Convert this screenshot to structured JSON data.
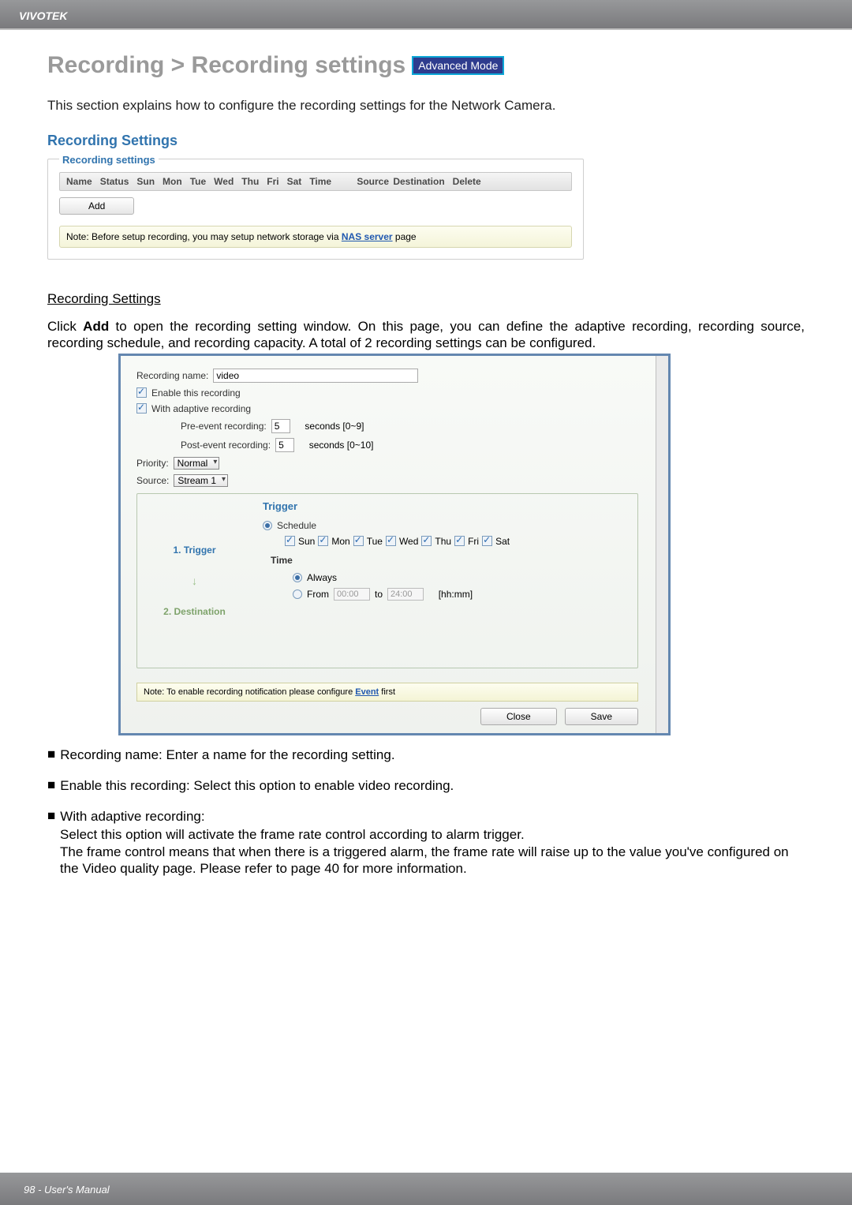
{
  "brand": "VIVOTEK",
  "page_title_prefix": "Recording > Recording settings",
  "mode_badge": "Advanced Mode",
  "intro": "This section explains how to configure the recording settings for the Network Camera.",
  "section_heading": "Recording Settings",
  "settings_panel": {
    "legend": "Recording settings",
    "columns": [
      "Name",
      "Status",
      "Sun",
      "Mon",
      "Tue",
      "Wed",
      "Thu",
      "Fri",
      "Sat",
      "Time",
      "Source",
      "Destination",
      "Delete"
    ],
    "add_button": "Add",
    "note_prefix": "Note: Before setup recording, you may setup network storage via ",
    "note_link": "NAS server",
    "note_suffix": " page"
  },
  "sub_heading": "Recording Settings",
  "main_para_before_add": "Click ",
  "main_para_add": "Add",
  "main_para_after_add": " to open the recording setting window. On this page, you can define the adaptive recording, recording source, recording schedule, and recording capacity. A total of 2 recording settings can be configured.",
  "dialog": {
    "recording_name_label": "Recording name:",
    "recording_name_value": "video",
    "enable_label": "Enable this recording",
    "adaptive_label": "With adaptive recording",
    "pre_event_label": "Pre-event recording:",
    "pre_event_value": "5",
    "pre_event_suffix": "seconds [0~9]",
    "post_event_label": "Post-event recording:",
    "post_event_value": "5",
    "post_event_suffix": "seconds [0~10]",
    "priority_label": "Priority:",
    "priority_value": "Normal",
    "source_label": "Source:",
    "source_value": "Stream 1",
    "trigger_title": "Trigger",
    "step1": "1. Trigger",
    "step2": "2. Destination",
    "schedule_label": "Schedule",
    "days": [
      "Sun",
      "Mon",
      "Tue",
      "Wed",
      "Thu",
      "Fri",
      "Sat"
    ],
    "time_label": "Time",
    "always_label": "Always",
    "from_label": "From",
    "from_value": "00:00",
    "to_label": "to",
    "to_value": "24:00",
    "hhmm": "[hh:mm]",
    "note_prefix": "Note: To enable recording notification please configure ",
    "note_link": "Event",
    "note_suffix": " first",
    "close_btn": "Close",
    "save_btn": "Save"
  },
  "bullets": {
    "b1": "Recording name: Enter a name for the recording setting.",
    "b2": "Enable this recording: Select this option to enable video recording.",
    "b3_head": "With adaptive recording:",
    "b3_l1": "Select this option will activate the frame rate control according to alarm trigger.",
    "b3_l2": "The frame control means that when there is a triggered alarm, the frame rate will raise up to the value you've configured on the Video quality page. Please refer to page 40 for more information."
  },
  "footer": "98 - User's Manual"
}
